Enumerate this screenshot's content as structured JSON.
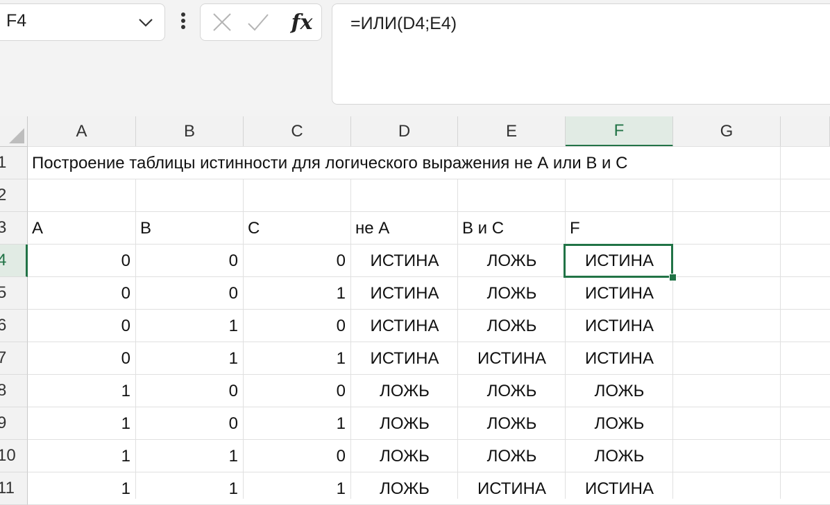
{
  "name_box": {
    "value": "F4"
  },
  "formula_bar": {
    "cancel_icon": "x-icon",
    "enter_icon": "check-icon",
    "fx_label": "fx",
    "formula": "=ИЛИ(D4;E4)"
  },
  "columns": [
    "A",
    "B",
    "C",
    "D",
    "E",
    "F",
    "G",
    ""
  ],
  "active_column": "F",
  "active_row": "4",
  "row_numbers": [
    "1",
    "2",
    "3",
    "4",
    "5",
    "6",
    "7",
    "8",
    "9",
    "10",
    "11"
  ],
  "sheet": {
    "title": "Построение таблицы истинности для логического выражения не А или B и C",
    "headers": [
      "A",
      "B",
      "C",
      "не A",
      "B и C",
      "F"
    ],
    "rows": [
      [
        "0",
        "0",
        "0",
        "ИСТИНА",
        "ЛОЖЬ",
        "ИСТИНА"
      ],
      [
        "0",
        "0",
        "1",
        "ИСТИНА",
        "ЛОЖЬ",
        "ИСТИНА"
      ],
      [
        "0",
        "1",
        "0",
        "ИСТИНА",
        "ЛОЖЬ",
        "ИСТИНА"
      ],
      [
        "0",
        "1",
        "1",
        "ИСТИНА",
        "ИСТИНА",
        "ИСТИНА"
      ],
      [
        "1",
        "0",
        "0",
        "ЛОЖЬ",
        "ЛОЖЬ",
        "ЛОЖЬ"
      ],
      [
        "1",
        "0",
        "1",
        "ЛОЖЬ",
        "ЛОЖЬ",
        "ЛОЖЬ"
      ],
      [
        "1",
        "1",
        "0",
        "ЛОЖЬ",
        "ЛОЖЬ",
        "ЛОЖЬ"
      ],
      [
        "1",
        "1",
        "1",
        "ЛОЖЬ",
        "ИСТИНА",
        "ИСТИНА"
      ]
    ]
  },
  "colors": {
    "accent": "#217346",
    "header_bg": "#f2f2f2",
    "gridline": "#e0e0e0"
  }
}
